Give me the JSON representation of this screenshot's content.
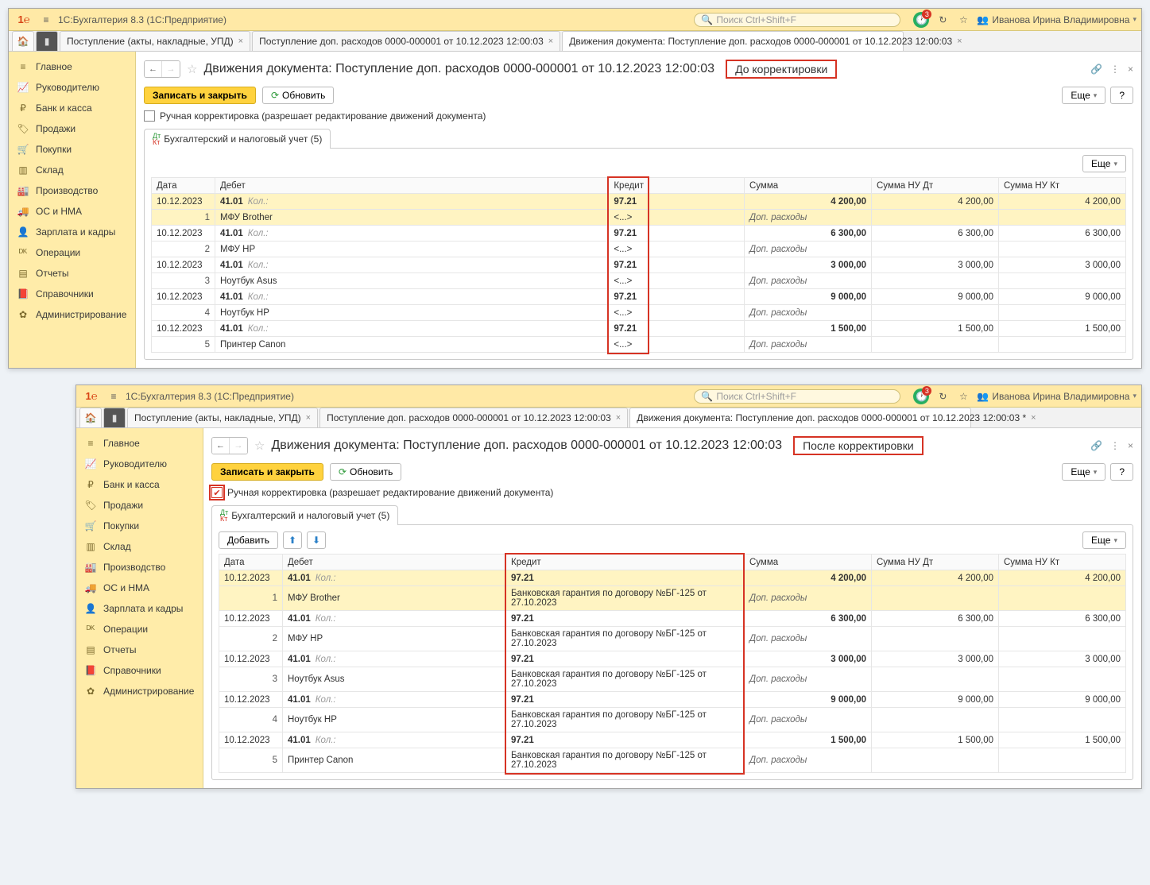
{
  "app": {
    "title": "1С:Бухгалтерия 8.3  (1С:Предприятие)",
    "search_placeholder": "Поиск Ctrl+Shift+F",
    "bell_badge": "3",
    "user": "Иванова Ирина Владимировна"
  },
  "tabs": {
    "t1": "Поступление (акты, накладные, УПД)",
    "t2": "Поступление доп. расходов 0000-000001 от 10.12.2023 12:00:03",
    "t3_a": "Движения документа: Поступление доп. расходов 0000-000001 от 10.12.2023 12:00:03",
    "t3_b": "Движения документа: Поступление доп. расходов 0000-000001 от 10.12.2023 12:00:03 *"
  },
  "sidebar": [
    {
      "icon": "≡",
      "label": "Главное"
    },
    {
      "icon": "📈",
      "label": "Руководителю"
    },
    {
      "icon": "₽",
      "label": "Банк и касса"
    },
    {
      "icon": "🏷",
      "label": "Продажи"
    },
    {
      "icon": "🛒",
      "label": "Покупки"
    },
    {
      "icon": "▥",
      "label": "Склад"
    },
    {
      "icon": "🏭",
      "label": "Производство"
    },
    {
      "icon": "🚚",
      "label": "ОС и НМА"
    },
    {
      "icon": "👤",
      "label": "Зарплата и кадры"
    },
    {
      "icon": "ᴰᴷ",
      "label": "Операции"
    },
    {
      "icon": "▤",
      "label": "Отчеты"
    },
    {
      "icon": "📕",
      "label": "Справочники"
    },
    {
      "icon": "✿",
      "label": "Администрирование"
    }
  ],
  "page": {
    "title": "Движения документа: Поступление доп. расходов 0000-000001 от 10.12.2023 12:00:03",
    "callout_before": "До  корректировки",
    "callout_after": "После  корректировки",
    "btn_save_close": "Записать и закрыть",
    "btn_refresh": "Обновить",
    "btn_more": "Еще",
    "btn_help": "?",
    "chk_manual": "Ручная корректировка (разрешает редактирование движений документа)",
    "sheet_tab": "Бухгалтерский и налоговый учет (5)",
    "btn_add": "Добавить"
  },
  "grid": {
    "headers": {
      "date": "Дата",
      "debit": "Дебет",
      "credit": "Кредит",
      "sum": "Сумма",
      "sum_nu_dt": "Сумма НУ Дт",
      "sum_nu_kt": "Сумма НУ Кт"
    },
    "kol": "Кол.:",
    "ellipsis": "<...>",
    "desc": "Доп. расходы",
    "credit_detail_after": "Банковская гарантия по договору №БГ-125 от 27.10.2023",
    "rows": [
      {
        "idx": "1",
        "date": "10.12.2023",
        "debit_acct": "41.01",
        "debit_name": "МФУ Brother",
        "credit_acct": "97.21",
        "sum": "4 200,00",
        "nu_dt": "4 200,00",
        "nu_kt": "4 200,00"
      },
      {
        "idx": "2",
        "date": "10.12.2023",
        "debit_acct": "41.01",
        "debit_name": "МФУ HP",
        "credit_acct": "97.21",
        "sum": "6 300,00",
        "nu_dt": "6 300,00",
        "nu_kt": "6 300,00"
      },
      {
        "idx": "3",
        "date": "10.12.2023",
        "debit_acct": "41.01",
        "debit_name": "Ноутбук Asus",
        "credit_acct": "97.21",
        "sum": "3 000,00",
        "nu_dt": "3 000,00",
        "nu_kt": "3 000,00"
      },
      {
        "idx": "4",
        "date": "10.12.2023",
        "debit_acct": "41.01",
        "debit_name": "Ноутбук HP",
        "credit_acct": "97.21",
        "sum": "9 000,00",
        "nu_dt": "9 000,00",
        "nu_kt": "9 000,00"
      },
      {
        "idx": "5",
        "date": "10.12.2023",
        "debit_acct": "41.01",
        "debit_name": "Принтер Canon",
        "credit_acct": "97.21",
        "sum": "1 500,00",
        "nu_dt": "1 500,00",
        "nu_kt": "1 500,00"
      }
    ]
  }
}
